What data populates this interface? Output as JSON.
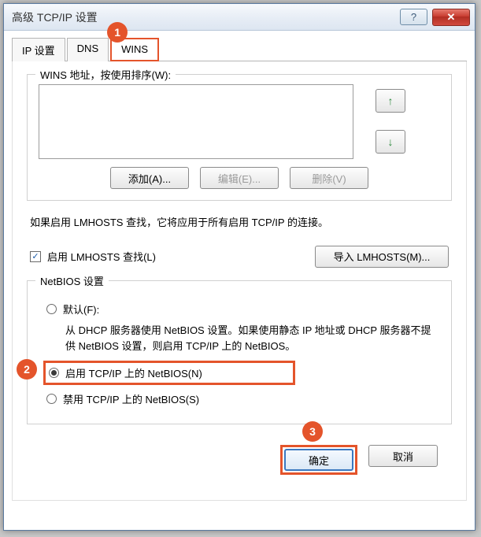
{
  "window": {
    "title": "高级 TCP/IP 设置",
    "help_glyph": "?",
    "close_glyph": "✕"
  },
  "tabs": {
    "ip": "IP 设置",
    "dns": "DNS",
    "wins": "WINS"
  },
  "callouts": {
    "one": "1",
    "two": "2",
    "three": "3"
  },
  "wins_group": {
    "legend": "WINS 地址，按使用排序(W):",
    "up_glyph": "↑",
    "down_glyph": "↓",
    "add": "添加(A)...",
    "edit": "编辑(E)...",
    "delete": "删除(V)"
  },
  "lmhosts": {
    "note": "如果启用 LMHOSTS 查找，它将应用于所有启用 TCP/IP 的连接。",
    "check_glyph": "✓",
    "enable_label": "启用 LMHOSTS 查找(L)",
    "import": "导入 LMHOSTS(M)..."
  },
  "netbios": {
    "legend": "NetBIOS 设置",
    "default_label": "默认(F):",
    "default_desc": "从 DHCP 服务器使用 NetBIOS 设置。如果使用静态 IP 地址或 DHCP 服务器不提供 NetBIOS 设置，则启用 TCP/IP 上的 NetBIOS。",
    "enable_label": "启用 TCP/IP 上的 NetBIOS(N)",
    "disable_label": "禁用 TCP/IP 上的 NetBIOS(S)"
  },
  "footer": {
    "ok": "确定",
    "cancel": "取消"
  }
}
